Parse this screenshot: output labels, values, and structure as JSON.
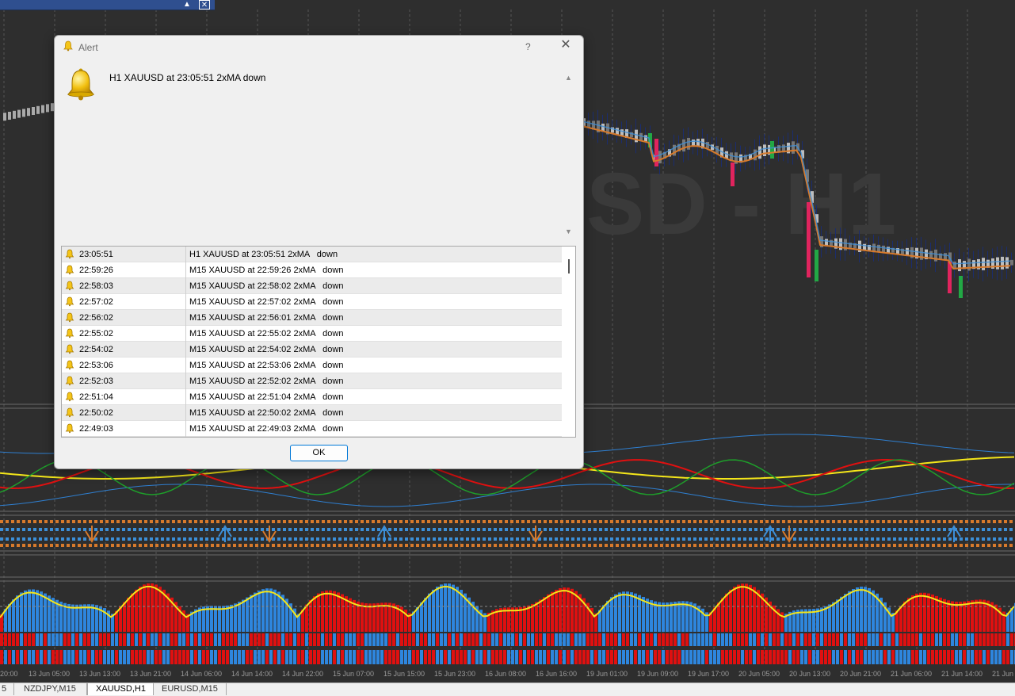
{
  "window": {
    "restore_glyph": "▲",
    "close_glyph": "✕"
  },
  "chart": {
    "watermark": "SD - H1",
    "time_axis": [
      "20:00",
      "13 Jun 05:00",
      "13 Jun 13:00",
      "13 Jun 21:00",
      "14 Jun 06:00",
      "14 Jun 14:00",
      "14 Jun 22:00",
      "15 Jun 07:00",
      "15 Jun 15:00",
      "15 Jun 23:00",
      "16 Jun 08:00",
      "16 Jun 16:00",
      "19 Jun 01:00",
      "19 Jun 09:00",
      "19 Jun 17:00",
      "20 Jun 05:00",
      "20 Jun 13:00",
      "20 Jun 21:00",
      "21 Jun 06:00",
      "21 Jun 14:00",
      "21 Jun"
    ],
    "colors": {
      "bull": "#22a845",
      "bear": "#e0245e",
      "ma_orange": "#d77a2c",
      "ma_blue": "#3c8fd8",
      "yellow": "#f4e61a",
      "hist_blue": "#2e86de",
      "hist_red": "#e01010"
    }
  },
  "tabs": [
    "5",
    "NZDJPY,M15",
    "XAUUSD,H1",
    "EURUSD,M15"
  ],
  "active_tab": "XAUUSD,H1",
  "dialog": {
    "title": "Alert",
    "help": "?",
    "close": "✕",
    "message": "H1 XAUUSD at 23:05:51 2xMA   down",
    "ok_label": "OK",
    "alerts": [
      {
        "time": "23:05:51",
        "text": "H1 XAUUSD at 23:05:51 2xMA   down"
      },
      {
        "time": "22:59:26",
        "text": "M15 XAUUSD at 22:59:26 2xMA   down"
      },
      {
        "time": "22:58:03",
        "text": "M15 XAUUSD at 22:58:02 2xMA   down"
      },
      {
        "time": "22:57:02",
        "text": "M15 XAUUSD at 22:57:02 2xMA   down"
      },
      {
        "time": "22:56:02",
        "text": "M15 XAUUSD at 22:56:01 2xMA   down"
      },
      {
        "time": "22:55:02",
        "text": "M15 XAUUSD at 22:55:02 2xMA   down"
      },
      {
        "time": "22:54:02",
        "text": "M15 XAUUSD at 22:54:02 2xMA   down"
      },
      {
        "time": "22:53:06",
        "text": "M15 XAUUSD at 22:53:06 2xMA   down"
      },
      {
        "time": "22:52:03",
        "text": "M15 XAUUSD at 22:52:02 2xMA   down"
      },
      {
        "time": "22:51:04",
        "text": "M15 XAUUSD at 22:51:04 2xMA   down"
      },
      {
        "time": "22:50:02",
        "text": "M15 XAUUSD at 22:50:02 2xMA   down"
      },
      {
        "time": "22:49:03",
        "text": "M15 XAUUSD at 22:49:03 2xMA   down"
      }
    ]
  }
}
